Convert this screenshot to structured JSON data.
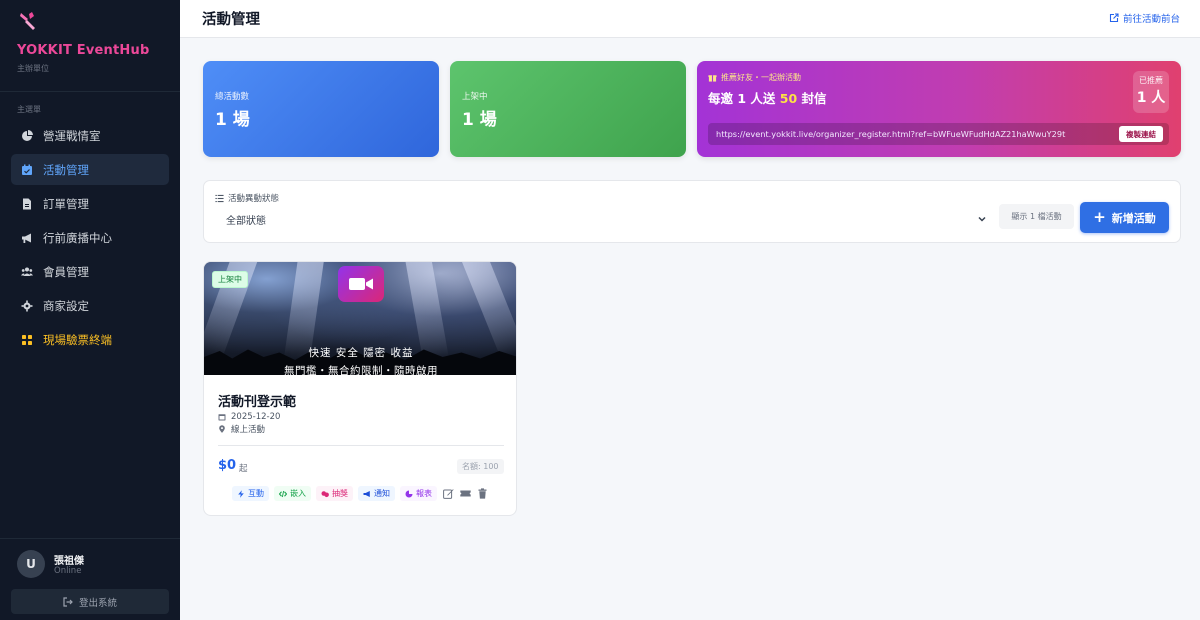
{
  "sidebar": {
    "brand_name": "YOKKIT EventHub",
    "brand_sub": "主辦單位",
    "menu_heading": "主選單",
    "items": [
      {
        "label": "營運戰情室",
        "icon": "pie-chart-icon"
      },
      {
        "label": "活動管理",
        "icon": "calendar-icon",
        "active": true
      },
      {
        "label": "訂單管理",
        "icon": "invoice-icon"
      },
      {
        "label": "行前廣播中心",
        "icon": "megaphone-icon"
      },
      {
        "label": "會員管理",
        "icon": "users-icon"
      },
      {
        "label": "商家設定",
        "icon": "gear-icon"
      },
      {
        "label": "現場驗票終端",
        "icon": "grid-icon",
        "accent": "#fbbf24"
      }
    ],
    "user": {
      "initial": "U",
      "name": "張祖傑",
      "status": "Online"
    },
    "logout_label": "登出系統"
  },
  "header": {
    "title": "活動管理",
    "front_link": "前往活動前台"
  },
  "stats": [
    {
      "label": "總活動數",
      "value": "1 場",
      "color": "#3b7ae8"
    },
    {
      "label": "上架中",
      "value": "1 場",
      "color": "#4cb35c"
    }
  ],
  "referral": {
    "kicker": "推薦好友・一起辦活動",
    "headline_prefix": "每邀 1 人送 ",
    "headline_highlight": "50",
    "headline_suffix": " 封信",
    "count_label": "已推薦",
    "count_value": "1 人",
    "url": "https://event.yokkit.live/organizer_register.html?ref=bWFueWFudHdAZ21haWwuY29t",
    "copy_label": "複製連結"
  },
  "filter": {
    "label": "活動異動狀態",
    "selected": "全部狀態",
    "count_text": "顯示 1 檔活動",
    "add_label": "新增活動"
  },
  "event": {
    "status": "上架中",
    "banner_line1": "快速 安全 隱密 收益",
    "banner_line2": "無門檻・無合約限制・隨時啟用",
    "title": "活動刊登示範",
    "date": "2025-12-20",
    "venue": "線上活動",
    "price": "$0",
    "price_suffix": "起",
    "quota": "名額: 100",
    "actions": [
      {
        "label": "互動",
        "icon": "bolt-icon"
      },
      {
        "label": "嵌入",
        "icon": "code-icon"
      },
      {
        "label": "抽獎",
        "icon": "gift-icon"
      },
      {
        "label": "通知",
        "icon": "megaphone-icon"
      },
      {
        "label": "報表",
        "icon": "pie-chart-icon"
      }
    ]
  }
}
